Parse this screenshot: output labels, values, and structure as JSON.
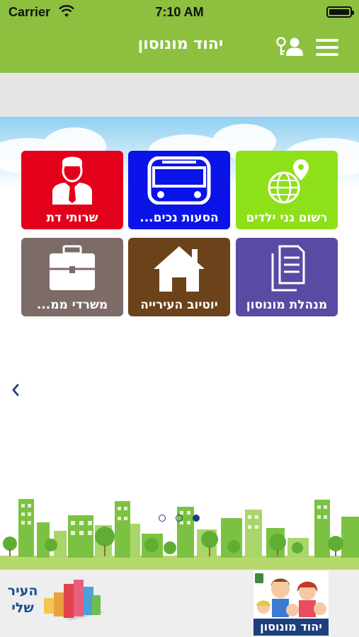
{
  "status_bar": {
    "carrier": "Carrier",
    "time": "7:10 AM"
  },
  "nav": {
    "title": "יהוד מונוסון"
  },
  "tiles": [
    {
      "label": "רשום גני ילדים",
      "color": "#8ee019",
      "icon": "globe-pin-icon"
    },
    {
      "label": "הסעות נכים...",
      "color": "#0a14e8",
      "icon": "bus-icon"
    },
    {
      "label": "שרותי דת",
      "color": "#e3001b",
      "icon": "person-icon"
    },
    {
      "label": "מנהלת מונוסון",
      "color": "#5a4aa3",
      "icon": "documents-icon"
    },
    {
      "label": "יוטיוב העירייה",
      "color": "#6b4219",
      "icon": "house-icon"
    },
    {
      "label": "משרדי ממ...",
      "color": "#7d6b68",
      "icon": "briefcase-icon"
    }
  ],
  "footer": {
    "left_logo_text": "העיר שלי",
    "right_logo_text": "יהוד מונוסון"
  },
  "page_indicator": {
    "pages": 3,
    "current": 3
  }
}
